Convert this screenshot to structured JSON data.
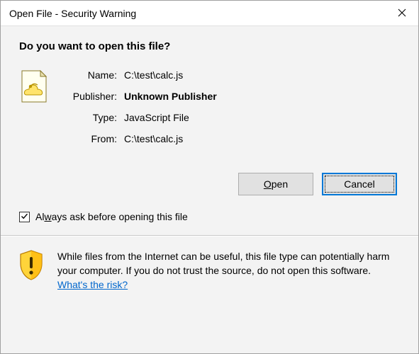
{
  "window": {
    "title": "Open File - Security Warning"
  },
  "heading": "Do you want to open this file?",
  "details": {
    "name_label": "Name:",
    "name_value": "C:\\test\\calc.js",
    "publisher_label": "Publisher:",
    "publisher_value": "Unknown Publisher",
    "type_label": "Type:",
    "type_value": "JavaScript File",
    "from_label": "From:",
    "from_value": "C:\\test\\calc.js"
  },
  "buttons": {
    "open_prefix": "O",
    "open_rest": "pen",
    "cancel": "Cancel"
  },
  "checkbox": {
    "checked": true,
    "label_prefix": "Al",
    "label_key": "w",
    "label_rest": "ays ask before opening this file"
  },
  "footer": {
    "text": "While files from the Internet can be useful, this file type can potentially harm your computer. If you do not trust the source, do not open this software. ",
    "link": "What's the risk?"
  },
  "icons": {
    "close": "close-icon",
    "file": "script-file-icon",
    "shield": "warning-shield-icon"
  }
}
